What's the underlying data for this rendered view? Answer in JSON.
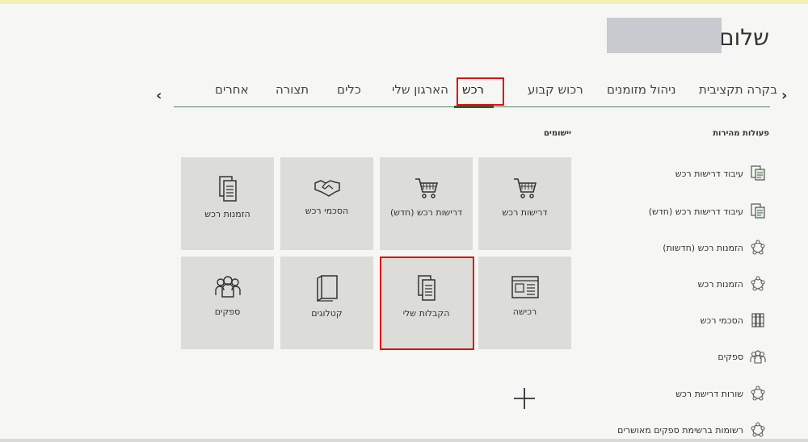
{
  "header": {
    "greeting": "שלום"
  },
  "tabs": [
    {
      "label": "בקרה תקציבית"
    },
    {
      "label": "ניהול מזומנים"
    },
    {
      "label": "רכוש קבוע"
    },
    {
      "label": "רכש"
    },
    {
      "label": "הארגון שלי"
    },
    {
      "label": "כלים"
    },
    {
      "label": "תצורה"
    },
    {
      "label": "אחרים"
    }
  ],
  "sections": {
    "quick_actions": "פעולות מהירות",
    "apps": "יישומים"
  },
  "tiles": [
    {
      "label": "דרישות רכש",
      "icon": "cart-icon"
    },
    {
      "label": "דרישות רכש (חדש)",
      "icon": "cart-icon"
    },
    {
      "label": "הסכמי רכש",
      "icon": "handshake-icon"
    },
    {
      "label": "הזמנות רכש",
      "icon": "documents-icon"
    },
    {
      "label": "רכישה",
      "icon": "catalog-layout-icon"
    },
    {
      "label": "הקבלות שלי",
      "icon": "documents-icon"
    },
    {
      "label": "קטלוגים",
      "icon": "book-icon"
    },
    {
      "label": "ספקים",
      "icon": "people-icon"
    }
  ],
  "quick_actions": [
    {
      "label": "עיבוד דרישות רכש",
      "icon": "document-process-icon"
    },
    {
      "label": "עיבוד דרישות רכש (חדש)",
      "icon": "document-process-icon"
    },
    {
      "label": "הזמנות רכש (חדשות)",
      "icon": "cycle-icon"
    },
    {
      "label": "הזמנות רכש",
      "icon": "cycle-icon"
    },
    {
      "label": "הסכמי רכש",
      "icon": "binders-icon"
    },
    {
      "label": "ספקים",
      "icon": "people-icon"
    },
    {
      "label": "שורות דרישת רכש",
      "icon": "cycle-icon"
    },
    {
      "label": "רשומות ברשימת ספקים מאושרים",
      "icon": "cycle-icon"
    }
  ],
  "colors": {
    "accent": "#2d5a2d",
    "highlight": "#dd1111",
    "tile": "#dcdcd8"
  }
}
